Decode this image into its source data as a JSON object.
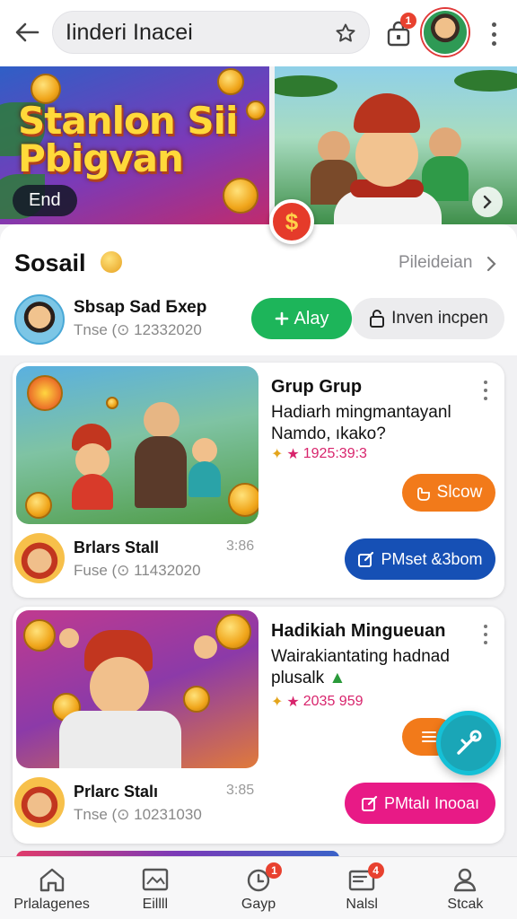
{
  "topbar": {
    "search_value": "Iinderi Inacei",
    "cart_badge": "1"
  },
  "banners": {
    "left_title": "Stanlon Sii Pbigvan",
    "left_pill": "End",
    "coin_symbol": "$"
  },
  "social": {
    "title": "Sosail",
    "see_all": "Pileideian",
    "user_name": "Sbsap Sad Бхер",
    "user_time": "Tnse (⊙ 12332020",
    "add_button": "Alay",
    "invite_button": "Inven incpen"
  },
  "cards": [
    {
      "title": "Grup Grup",
      "desc": "Hadiarh mingmantayanl Namdo, ıkako?",
      "stat": "1925:39:3",
      "action": "Slcow",
      "author": "Brlars Stall",
      "author_time": "Fuse (⊙ 11432020",
      "clock": "3:86",
      "cta": "PMset &3bom",
      "cta_color": "#1650b5"
    },
    {
      "title": "Hadikiah Mingueuan",
      "desc": "Wairakiantating hadnad plusalk",
      "stat": "2035 959",
      "action": "",
      "author": "Prlarc Stalı",
      "author_time": "Tnse (⊙ 10231030",
      "clock": "3:85",
      "cta": "PMtalı Inooaı",
      "cta_color": "#e81a86"
    }
  ],
  "bottomnav": {
    "items": [
      {
        "label": "Prlalagenes",
        "icon": "home-icon",
        "badge": ""
      },
      {
        "label": "Eillll",
        "icon": "gallery-icon",
        "badge": ""
      },
      {
        "label": "Gayp",
        "icon": "clock-icon",
        "badge": "1"
      },
      {
        "label": "Nalsl",
        "icon": "inbox-icon",
        "badge": "4"
      },
      {
        "label": "Stcak",
        "icon": "person-icon",
        "badge": ""
      }
    ]
  },
  "colors": {
    "accent_green": "#1db55a",
    "accent_orange": "#f27a1a",
    "accent_blue": "#1650b5",
    "accent_pink": "#e81a86",
    "badge_red": "#e8412f",
    "fab_teal": "#1aa6b7"
  }
}
